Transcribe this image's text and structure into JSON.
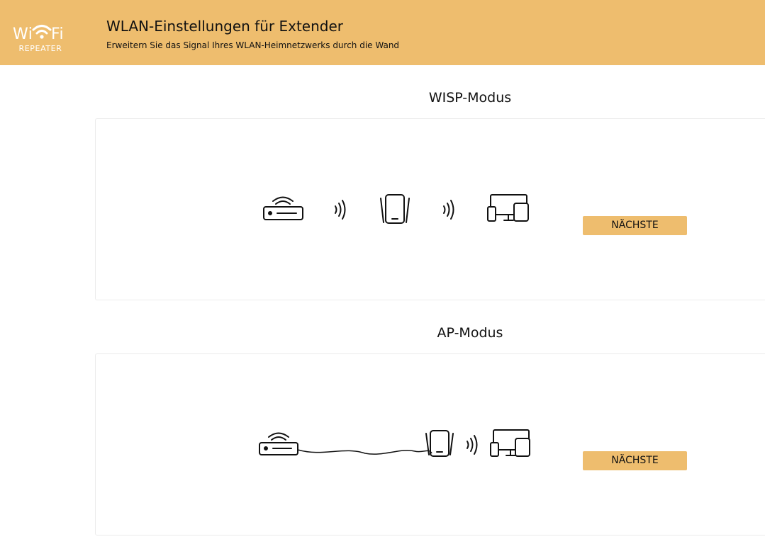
{
  "header": {
    "logo": {
      "word_left": "Wi",
      "word_right": "Fi",
      "subtitle": "REPEATER"
    },
    "title": "WLAN-Einstellungen für Extender",
    "subtitle": "Erweitern Sie das Signal Ihres WLAN-Heimnetzwerks durch die Wand"
  },
  "modes": [
    {
      "title": "WISP-Modus",
      "button_label": "NÄCHSTE",
      "icons": [
        "router-icon",
        "wireless-signal-icon",
        "repeater-icon",
        "wireless-signal-icon",
        "devices-icon"
      ]
    },
    {
      "title": "AP-Modus",
      "button_label": "NÄCHSTE",
      "icons": [
        "router-icon",
        "cable-icon",
        "repeater-icon",
        "wireless-signal-icon",
        "devices-icon"
      ]
    }
  ],
  "colors": {
    "accent": "#eebd6e",
    "panel_border": "#ebebeb",
    "icon_stroke": "#111111"
  }
}
